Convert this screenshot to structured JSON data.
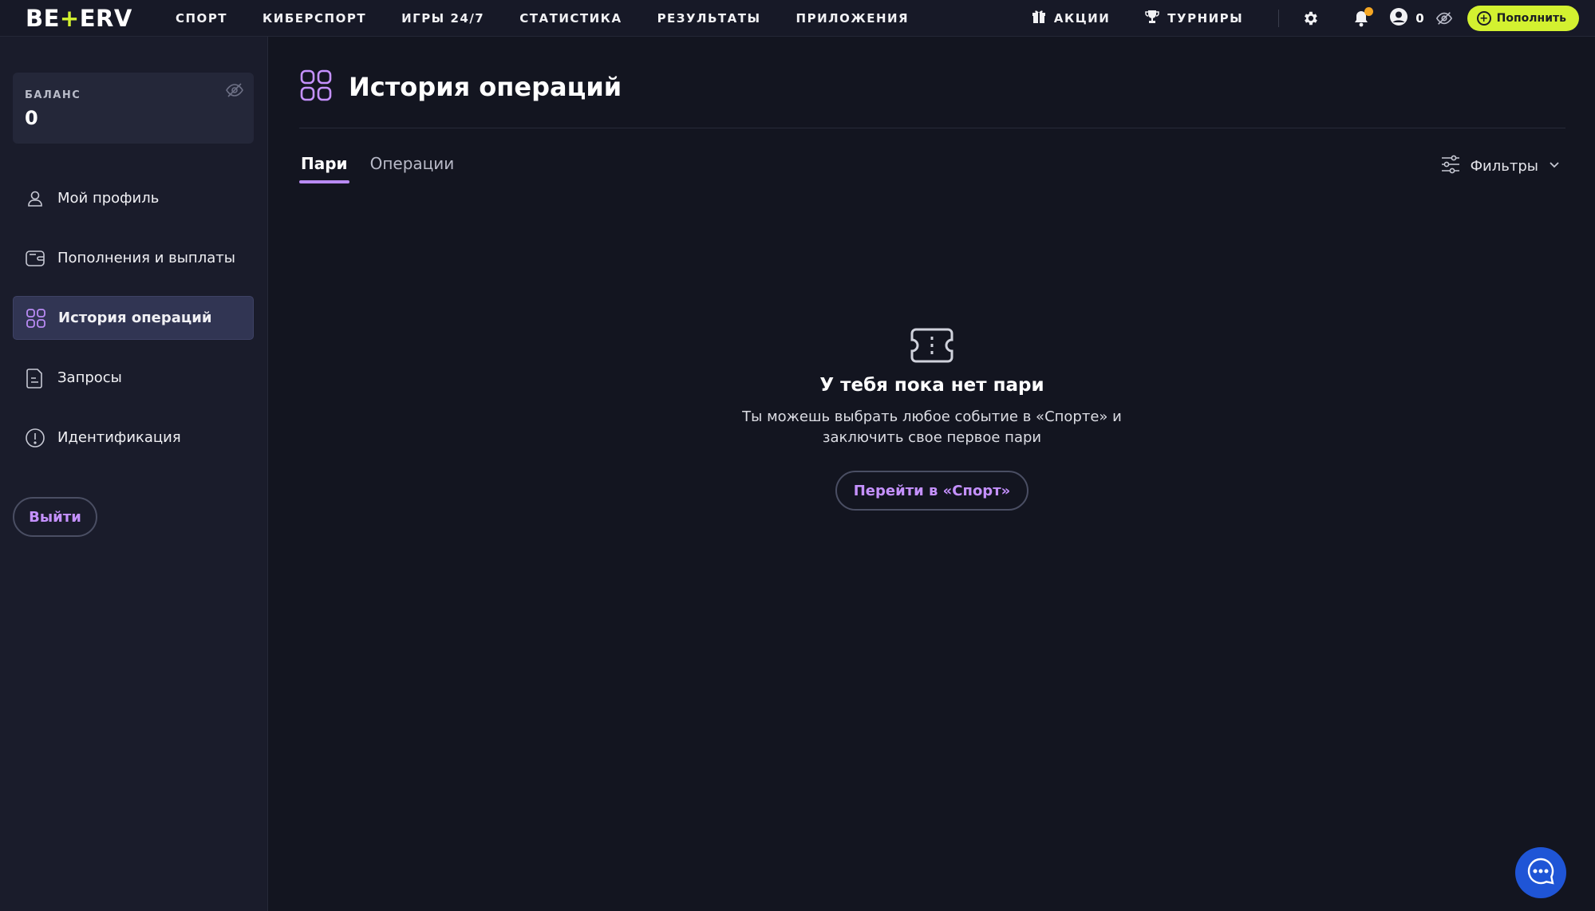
{
  "brand": {
    "logo": "BETERV",
    "accent": "#d3f130"
  },
  "nav": [
    {
      "label": "СПОРТ"
    },
    {
      "label": "КИБЕРСПОРТ"
    },
    {
      "label": "ИГРЫ 24/7"
    },
    {
      "label": "СТАТИСТИКА"
    },
    {
      "label": "РЕЗУЛЬТАТЫ"
    },
    {
      "label": "ПРИЛОЖЕНИЯ"
    }
  ],
  "header": {
    "promo_label": "АКЦИИ",
    "tournaments_label": "ТУРНИРЫ",
    "account_count": "0",
    "deposit_label": "Пополнить",
    "notification_color": "#f5a623"
  },
  "sidebar": {
    "balance_label": "БАЛАНС",
    "balance_value": "0",
    "items": [
      {
        "label": "Мой профиль",
        "icon": "user-icon"
      },
      {
        "label": "Пополнения и выплаты",
        "icon": "wallet-icon"
      },
      {
        "label": "История операций",
        "icon": "grid-icon",
        "active": true
      },
      {
        "label": "Запросы",
        "icon": "document-icon"
      },
      {
        "label": "Идентификация",
        "icon": "alert-circle-icon"
      }
    ],
    "logout_label": "Выйти"
  },
  "main": {
    "title": "История операций",
    "tabs": [
      {
        "label": "Пари",
        "active": true
      },
      {
        "label": "Операции"
      }
    ],
    "filters_label": "Фильтры",
    "empty": {
      "title": "У тебя пока нет пари",
      "text_line1": "Ты можешь выбрать любое событие в «Спорте» и",
      "text_line2": "заключить свое первое пари",
      "button": "Перейти в «Спорт»"
    }
  },
  "colors": {
    "tab_accent": "#b98bf4",
    "link": "#c591ff",
    "chat_button": "#1f55d6"
  }
}
